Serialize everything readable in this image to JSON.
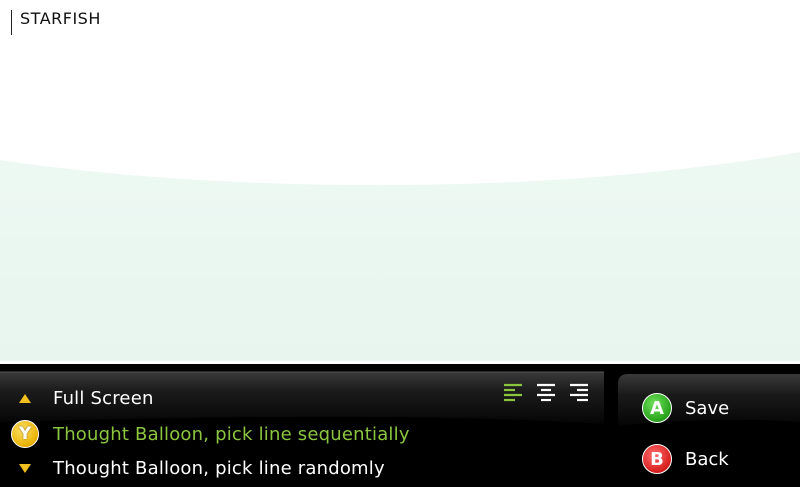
{
  "editor": {
    "text": "STARFISH",
    "background_color": "#ffffff",
    "wave_color": "#eaf6f0"
  },
  "menu": {
    "items": [
      {
        "icon": "up-arrow-icon",
        "label": "Full Screen",
        "selected": false
      },
      {
        "icon": "y-button-icon",
        "icon_letter": "Y",
        "label": "Thought Balloon, pick line sequentially",
        "selected": true
      },
      {
        "icon": "down-arrow-icon",
        "label": "Thought Balloon, pick line randomly",
        "selected": false
      }
    ],
    "alignment_options": [
      {
        "icon": "align-left-icon",
        "active": true
      },
      {
        "icon": "align-center-icon",
        "active": false
      },
      {
        "icon": "align-right-icon",
        "active": false
      }
    ],
    "selected_color": "#8cc63f",
    "accent_color": "#f2c01e"
  },
  "actions": {
    "save": {
      "letter": "A",
      "label": "Save",
      "color": "#27a21a"
    },
    "back": {
      "letter": "B",
      "label": "Back",
      "color": "#d71e1e"
    }
  }
}
